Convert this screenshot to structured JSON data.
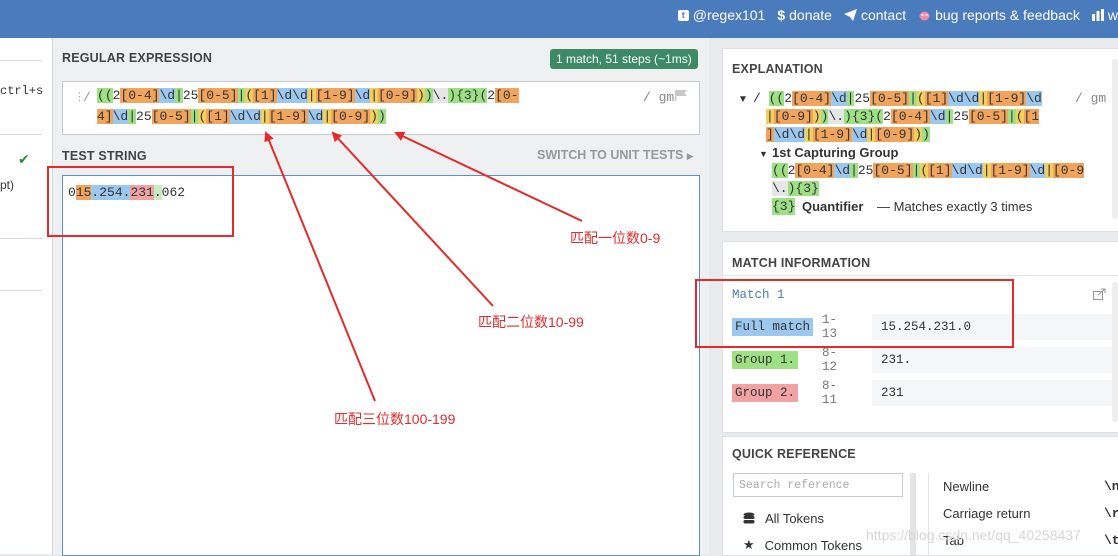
{
  "topbar": {
    "links": [
      {
        "icon": "twitter-icon",
        "label": "@regex101"
      },
      {
        "icon": "dollar-icon",
        "label": "donate"
      },
      {
        "icon": "send-icon",
        "label": "contact"
      },
      {
        "icon": "bug-icon",
        "label": "bug reports & feedback"
      },
      {
        "icon": "wiki-icon",
        "label": "w"
      }
    ]
  },
  "left": {
    "shortcut": "ctrl+s",
    "item": "pt)"
  },
  "regex_panel": {
    "header": "REGULAR EXPRESSION",
    "badge": "1 match, 51 steps (~1ms)",
    "slash": "/",
    "flags": "/ gm",
    "line1": [
      {
        "t": "(",
        "c": "g"
      },
      {
        "t": "(",
        "c": "g"
      },
      {
        "t": "2",
        "c": ""
      },
      {
        "t": "[0-4]",
        "c": "o"
      },
      {
        "t": "\\d",
        "c": "b"
      },
      {
        "t": "|",
        "c": "g"
      },
      {
        "t": "25",
        "c": ""
      },
      {
        "t": "[0-5]",
        "c": "o"
      },
      {
        "t": "|",
        "c": "g"
      },
      {
        "t": "(",
        "c": "y"
      },
      {
        "t": "[1]",
        "c": "o"
      },
      {
        "t": "\\d",
        "c": "b"
      },
      {
        "t": "\\d",
        "c": "b"
      },
      {
        "t": "|",
        "c": "y"
      },
      {
        "t": "[1-9]",
        "c": "o"
      },
      {
        "t": "\\d",
        "c": "b"
      },
      {
        "t": "|",
        "c": "y"
      },
      {
        "t": "[0-9]",
        "c": "o"
      },
      {
        "t": ")",
        "c": "y"
      },
      {
        "t": ")",
        "c": "g"
      },
      {
        "t": "\\.",
        "c": "gray"
      },
      {
        "t": ")",
        "c": "g"
      },
      {
        "t": "{3}",
        "c": "g"
      },
      {
        "t": "(",
        "c": "g"
      },
      {
        "t": "2",
        "c": ""
      },
      {
        "t": "[0-",
        "c": "o"
      }
    ],
    "line2": [
      {
        "t": "4]",
        "c": "o"
      },
      {
        "t": "\\d",
        "c": "b"
      },
      {
        "t": "|",
        "c": "g"
      },
      {
        "t": "25",
        "c": ""
      },
      {
        "t": "[0-5]",
        "c": "o"
      },
      {
        "t": "|",
        "c": "g"
      },
      {
        "t": "(",
        "c": "y"
      },
      {
        "t": "[1]",
        "c": "o"
      },
      {
        "t": "\\d",
        "c": "b"
      },
      {
        "t": "\\d",
        "c": "b"
      },
      {
        "t": "|",
        "c": "y"
      },
      {
        "t": "[1-9]",
        "c": "o"
      },
      {
        "t": "\\d",
        "c": "b"
      },
      {
        "t": "|",
        "c": "y"
      },
      {
        "t": "[0-9]",
        "c": "o"
      },
      {
        "t": ")",
        "c": "y"
      },
      {
        "t": ")",
        "c": "g"
      }
    ]
  },
  "test_panel": {
    "header": "TEST STRING",
    "switch_label": "SWITCH TO UNIT TESTS",
    "segments": [
      {
        "t": "0",
        "c": ""
      },
      {
        "t": "15",
        "c": "o"
      },
      {
        "t": ".254.",
        "c": "b"
      },
      {
        "t": "231",
        "c": "p"
      },
      {
        "t": ".",
        "c": "l"
      },
      {
        "t": "062",
        "c": ""
      }
    ]
  },
  "explanation": {
    "header": "EXPLANATION",
    "flags": "/ gm",
    "line1": [
      {
        "t": "/ ",
        "c": ""
      },
      {
        "t": "(",
        "c": "g"
      },
      {
        "t": "(",
        "c": "g"
      },
      {
        "t": "2",
        "c": ""
      },
      {
        "t": "[0-4]",
        "c": "o"
      },
      {
        "t": "\\d",
        "c": "b"
      },
      {
        "t": "|",
        "c": "g"
      },
      {
        "t": "25",
        "c": ""
      },
      {
        "t": "[0-5]",
        "c": "o"
      },
      {
        "t": "|",
        "c": "g"
      },
      {
        "t": "(",
        "c": "y"
      },
      {
        "t": "[1]",
        "c": "o"
      },
      {
        "t": "\\d",
        "c": "b"
      },
      {
        "t": "\\d",
        "c": "b"
      },
      {
        "t": "|",
        "c": "y"
      },
      {
        "t": "[1-9]",
        "c": "o"
      },
      {
        "t": "\\d",
        "c": "b"
      }
    ],
    "line2": [
      {
        "t": "|",
        "c": "y"
      },
      {
        "t": "[0-9]",
        "c": "o"
      },
      {
        "t": ")",
        "c": "y"
      },
      {
        "t": ")",
        "c": "g"
      },
      {
        "t": "\\.",
        "c": "gray"
      },
      {
        "t": ")",
        "c": "g"
      },
      {
        "t": "{3}",
        "c": "g"
      },
      {
        "t": "(",
        "c": "g"
      },
      {
        "t": "2",
        "c": ""
      },
      {
        "t": "[0-4]",
        "c": "o"
      },
      {
        "t": "\\d",
        "c": "b"
      },
      {
        "t": "|",
        "c": "g"
      },
      {
        "t": "25",
        "c": ""
      },
      {
        "t": "[0-5]",
        "c": "o"
      },
      {
        "t": "|",
        "c": "g"
      },
      {
        "t": "(",
        "c": "y"
      },
      {
        "t": "[1",
        "c": "o"
      }
    ],
    "line3": [
      {
        "t": "]",
        "c": "o"
      },
      {
        "t": "\\d",
        "c": "b"
      },
      {
        "t": "\\d",
        "c": "b"
      },
      {
        "t": "|",
        "c": "y"
      },
      {
        "t": "[1-9]",
        "c": "o"
      },
      {
        "t": "\\d",
        "c": "b"
      },
      {
        "t": "|",
        "c": "y"
      },
      {
        "t": "[0-9]",
        "c": "o"
      },
      {
        "t": ")",
        "c": "y"
      },
      {
        "t": ")",
        "c": "g"
      }
    ],
    "group_title": "1st Capturing Group",
    "line4": [
      {
        "t": "(",
        "c": "g"
      },
      {
        "t": "(",
        "c": "g"
      },
      {
        "t": "2",
        "c": ""
      },
      {
        "t": "[0-4]",
        "c": "o"
      },
      {
        "t": "\\d",
        "c": "b"
      },
      {
        "t": "|",
        "c": "g"
      },
      {
        "t": "25",
        "c": ""
      },
      {
        "t": "[0-5]",
        "c": "o"
      },
      {
        "t": "|",
        "c": "g"
      },
      {
        "t": "(",
        "c": "y"
      },
      {
        "t": "[1]",
        "c": "o"
      },
      {
        "t": "\\d",
        "c": "b"
      },
      {
        "t": "\\d",
        "c": "b"
      },
      {
        "t": "|",
        "c": "y"
      },
      {
        "t": "[1-9]",
        "c": "o"
      },
      {
        "t": "\\d",
        "c": "b"
      },
      {
        "t": "|",
        "c": "y"
      },
      {
        "t": "[0-9",
        "c": "o"
      }
    ],
    "line5": [
      {
        "t": "\\.",
        "c": "gray"
      },
      {
        "t": ")",
        "c": "g"
      },
      {
        "t": "{3}",
        "c": "g"
      }
    ],
    "quantifier_code": "{3}",
    "quantifier_label": "Quantifier",
    "quantifier_text": "— Matches exactly 3 times"
  },
  "match_info": {
    "header": "MATCH INFORMATION",
    "match_title": "Match 1",
    "rows": [
      {
        "label": "Full match",
        "range": "1-13",
        "value": "15.254.231.0",
        "c": "b"
      },
      {
        "label": "Group 1.",
        "range": "8-12",
        "value": "231.",
        "c": "g"
      },
      {
        "label": "Group 2.",
        "range": "8-11",
        "value": "231",
        "c": "p"
      }
    ]
  },
  "quick_ref": {
    "header": "QUICK REFERENCE",
    "search_placeholder": "Search reference",
    "items": [
      {
        "icon": "database-icon",
        "label": "All Tokens"
      },
      {
        "icon": "star-icon",
        "label": "Common Tokens"
      }
    ],
    "right_items": [
      {
        "label": "Newline",
        "code": "\\n"
      },
      {
        "label": "Carriage return",
        "code": "\\r"
      },
      {
        "label": "Tab",
        "code": "\\t"
      }
    ]
  },
  "annotations": {
    "a1": "匹配一位数0-9",
    "a2": "匹配二位数10-99",
    "a3": "匹配三位数100-199"
  },
  "watermark": "https://blog.csdn.net/qq_40258437",
  "colors": {
    "topbar": "#4a7bbd",
    "badge": "#3d8b64",
    "annotation_red": "#e32b2b",
    "token_green": "#9ee084",
    "token_blue": "#9cc8f0",
    "token_orange": "#f1a45c",
    "token_yellow": "#f4cf5e",
    "token_pink": "#f1a3a3"
  }
}
